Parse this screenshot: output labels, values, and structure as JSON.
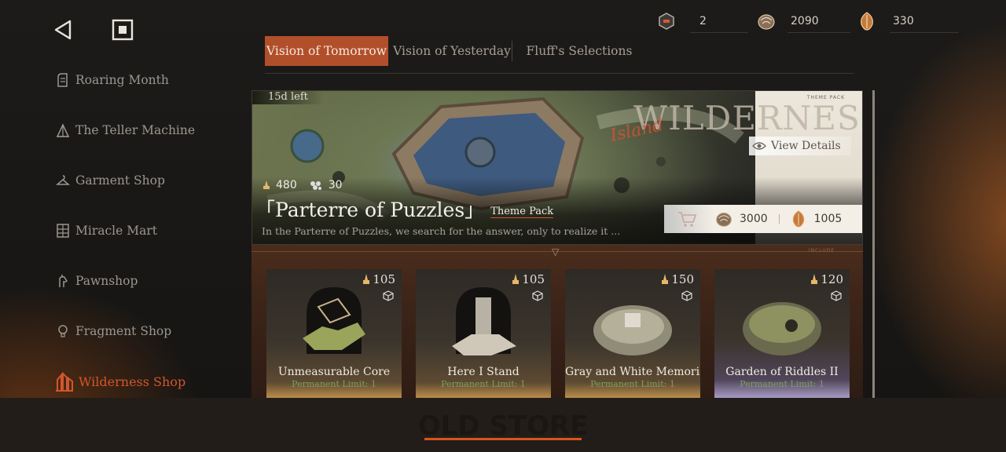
{
  "sidebar": {
    "items": [
      {
        "label": "Roaring Month",
        "icon": "piano-icon",
        "active": false
      },
      {
        "label": "The Teller Machine",
        "icon": "tent-icon",
        "active": false
      },
      {
        "label": "Garment Shop",
        "icon": "hanger-icon",
        "active": false
      },
      {
        "label": "Miracle Mart",
        "icon": "shelf-icon",
        "active": false
      },
      {
        "label": "Pawnshop",
        "icon": "hand-icon",
        "active": false
      },
      {
        "label": "Fragment Shop",
        "icon": "bulb-icon",
        "active": false
      },
      {
        "label": "Wilderness Shop",
        "icon": "island-icon",
        "active": true
      }
    ]
  },
  "currency": [
    {
      "icon": "ticket-icon",
      "value": "2"
    },
    {
      "icon": "shell-icon",
      "value": "2090"
    },
    {
      "icon": "feather-coin-icon",
      "value": "330"
    }
  ],
  "tabs": [
    {
      "label": "Vision of Tomorrow",
      "active": true
    },
    {
      "label": "Vision of Yesterday",
      "active": false
    },
    {
      "label": "Fluff's Selections",
      "active": false
    }
  ],
  "banner": {
    "time_left": "15d left",
    "brand_title": "WILDERNESS",
    "brand_script": "Island",
    "brand_tag": "THEME PACK",
    "view_details": "View Details",
    "stat1": "480",
    "stat2": "30",
    "title": "「Parterre of Puzzles」",
    "tag": "Theme Pack",
    "description": "In the Parterre of Puzzles, we search for the answer, only to realize it ...",
    "price_shell": "3000",
    "price_coin": "1005",
    "include_label": "INCLUDE"
  },
  "cards": [
    {
      "name": "Unmeasurable Core",
      "value": "105",
      "limit": "Permanent Limit: 1",
      "accent": "gold"
    },
    {
      "name": "Here I Stand",
      "value": "105",
      "limit": "Permanent Limit: 1",
      "accent": "gold"
    },
    {
      "name": "Gray and White Memorial",
      "value": "150",
      "limit": "Permanent Limit: 1",
      "accent": "gold"
    },
    {
      "name": "Garden of Riddles II",
      "value": "120",
      "limit": "Permanent Limit: 1",
      "accent": "purple"
    }
  ],
  "footer": {
    "title": "OLD STORE"
  },
  "colors": {
    "accent": "#b24f2b",
    "active_sidebar": "#d2562c",
    "footer_bar": "#d8541e"
  }
}
